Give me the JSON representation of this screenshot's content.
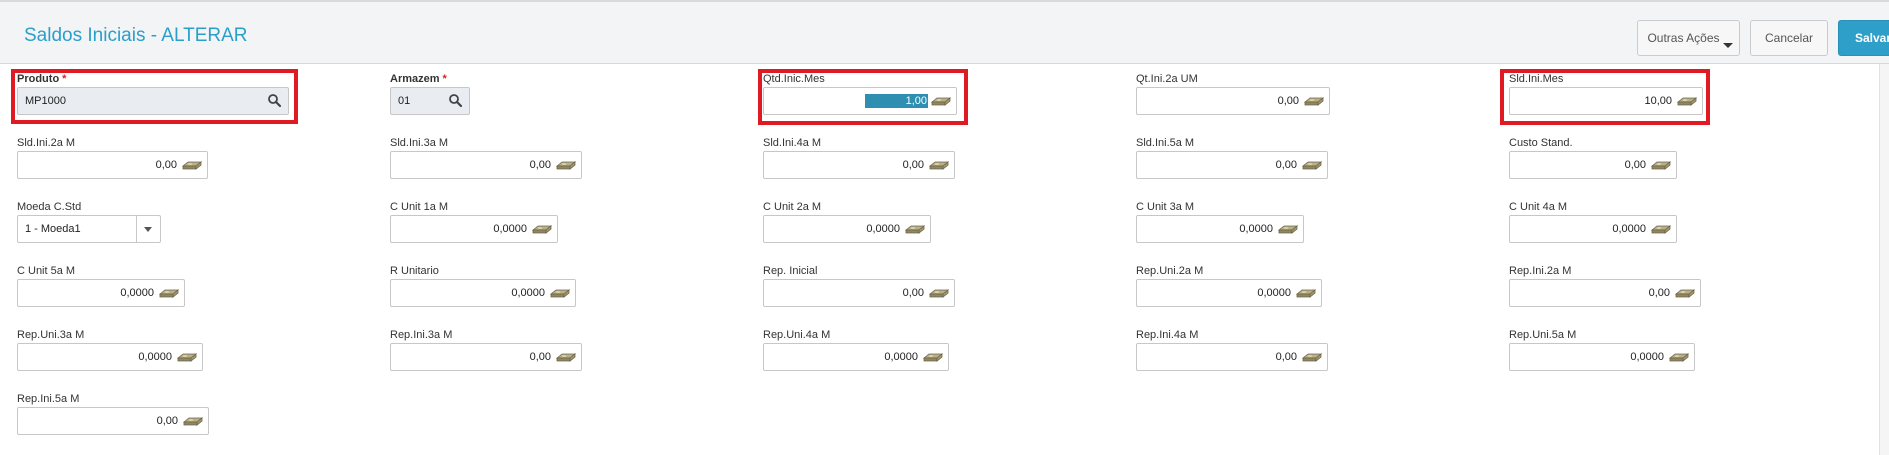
{
  "header": {
    "title": "Saldos Iniciais - ALTERAR",
    "outras_acoes": "Outras Ações",
    "cancelar": "Cancelar",
    "salvar": "Salvar"
  },
  "fields": {
    "produto": {
      "label": "Produto",
      "required": "*",
      "value": "MP1000"
    },
    "armazem": {
      "label": "Armazem",
      "required": "*",
      "value": "01"
    },
    "qtd_inic_mes": {
      "label": "Qtd.Inic.Mes",
      "value": "1,00"
    },
    "qt_ini_2a_um": {
      "label": "Qt.Ini.2a UM",
      "value": "0,00"
    },
    "sld_ini_mes": {
      "label": "Sld.Ini.Mes",
      "value": "10,00"
    },
    "sld_ini_2a_m": {
      "label": "Sld.Ini.2a M",
      "value": "0,00"
    },
    "sld_ini_3a_m": {
      "label": "Sld.Ini.3a M",
      "value": "0,00"
    },
    "sld_ini_4a_m": {
      "label": "Sld.Ini.4a M",
      "value": "0,00"
    },
    "sld_ini_5a_m": {
      "label": "Sld.Ini.5a M",
      "value": "0,00"
    },
    "custo_stand": {
      "label": "Custo Stand.",
      "value": "0,00"
    },
    "moeda_c_std": {
      "label": "Moeda C.Std",
      "value": "1 - Moeda1"
    },
    "c_unit_1a_m": {
      "label": "C Unit 1a M",
      "value": "0,0000"
    },
    "c_unit_2a_m": {
      "label": "C Unit 2a M",
      "value": "0,0000"
    },
    "c_unit_3a_m": {
      "label": "C Unit 3a M",
      "value": "0,0000"
    },
    "c_unit_4a_m": {
      "label": "C Unit 4a M",
      "value": "0,0000"
    },
    "c_unit_5a_m": {
      "label": "C Unit 5a M",
      "value": "0,0000"
    },
    "r_unitario": {
      "label": "R Unitario",
      "value": "0,0000"
    },
    "rep_inicial": {
      "label": "Rep. Inicial",
      "value": "0,00"
    },
    "rep_uni_2a_m": {
      "label": "Rep.Uni.2a M",
      "value": "0,0000"
    },
    "rep_ini_2a_m": {
      "label": "Rep.Ini.2a M",
      "value": "0,00"
    },
    "rep_uni_3a_m": {
      "label": "Rep.Uni.3a M",
      "value": "0,0000"
    },
    "rep_ini_3a_m": {
      "label": "Rep.Ini.3a M",
      "value": "0,00"
    },
    "rep_uni_4a_m": {
      "label": "Rep.Uni.4a M",
      "value": "0,0000"
    },
    "rep_ini_4a_m": {
      "label": "Rep.Ini.4a M",
      "value": "0,00"
    },
    "rep_uni_5a_m": {
      "label": "Rep.Uni.5a M",
      "value": "0,0000"
    },
    "rep_ini_5a_m": {
      "label": "Rep.Ini.5a M",
      "value": "0,00"
    }
  },
  "icons": {
    "money": "money-icon",
    "search": "search-icon",
    "dropdown": "chevron-down-icon"
  },
  "colors": {
    "accent": "#2e9fc9",
    "highlight": "#e01a22"
  }
}
